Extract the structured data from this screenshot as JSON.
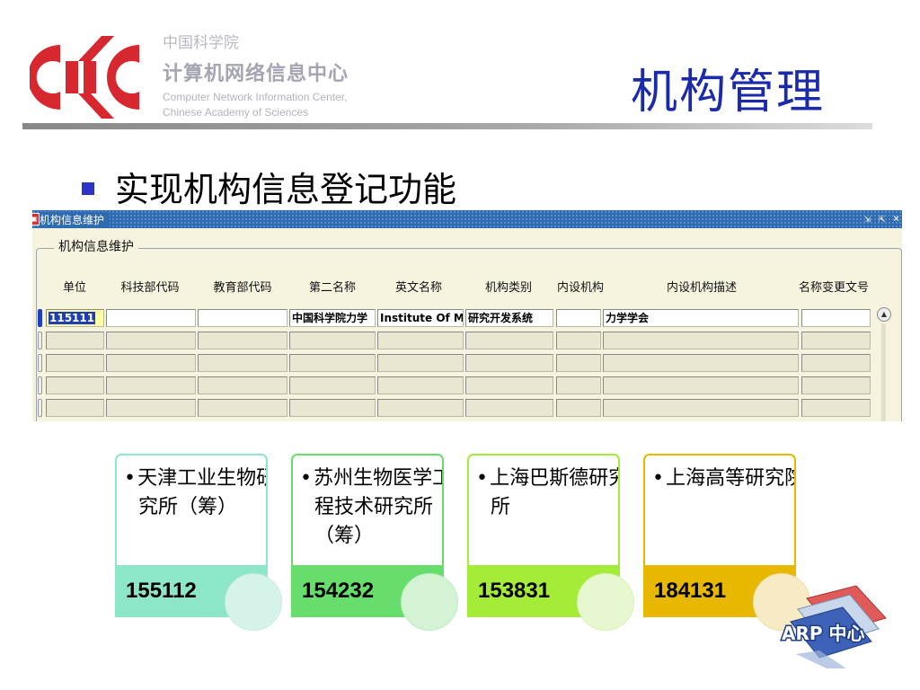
{
  "header": {
    "org_cn_small": "中国科学院",
    "org_cn_big": "计算机网络信息中心",
    "org_en_line1": "Computer Network Information Center,",
    "org_en_line2": "Chinese Academy of Sciences",
    "title": "机构管理"
  },
  "bullet": "实现机构信息登记功能",
  "form": {
    "window_title": "机构信息维护",
    "group_label": "机构信息维护",
    "window_controls": [
      "⇲",
      "⇱",
      "×"
    ],
    "columns": [
      "单位",
      "科技部代码",
      "教育部代码",
      "第二名称",
      "英文名称",
      "机构类别",
      "内设机构",
      "内设机构描述",
      "名称变更文号"
    ],
    "row1": [
      "115111",
      "",
      "",
      "中国科学院力学",
      "Institute Of Me",
      "研究开发系统",
      "",
      "力学学会",
      ""
    ]
  },
  "cards": [
    {
      "name": "天津工业生物研究所（筹）",
      "code": "155112"
    },
    {
      "name": "苏州生物医学工程技术研究所（筹）",
      "code": "154232"
    },
    {
      "name": "上海巴斯德研究所",
      "code": "153831"
    },
    {
      "name": "上海高等研究院",
      "code": "184131"
    }
  ],
  "arp_logo_text": "ARP 中心",
  "colors": {
    "title_blue": "#1a2aa8",
    "logo_red": "#d7282f",
    "card1": "#8ee6c9",
    "card2": "#67dd6b",
    "card3": "#a4ec37",
    "card4": "#e8b800"
  }
}
